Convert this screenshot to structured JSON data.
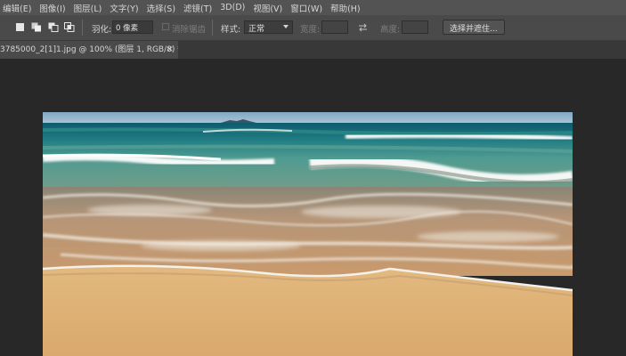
{
  "menu": [
    "编辑(E)",
    "图像(I)",
    "图层(L)",
    "文字(Y)",
    "选择(S)",
    "滤镜(T)",
    "3D(D)",
    "视图(V)",
    "窗口(W)",
    "帮助(H)"
  ],
  "options": {
    "feather_label": "羽化:",
    "feather_value": "0 像素",
    "anti_alias_label": "消除锯齿",
    "style_label": "样式:",
    "style_value": "正常",
    "width_label": "宽度:",
    "height_label": "高度:",
    "select_mask_button": "选择并遮住..."
  },
  "document": {
    "tab_title": "3785000_2[1]1.jpg @ 100% (图层 1, RGB/8) *",
    "close_glyph": "×"
  },
  "icons": [
    "new-selection-icon",
    "add-selection-icon",
    "subtract-selection-icon",
    "intersect-selection-icon",
    "swap-icon"
  ]
}
